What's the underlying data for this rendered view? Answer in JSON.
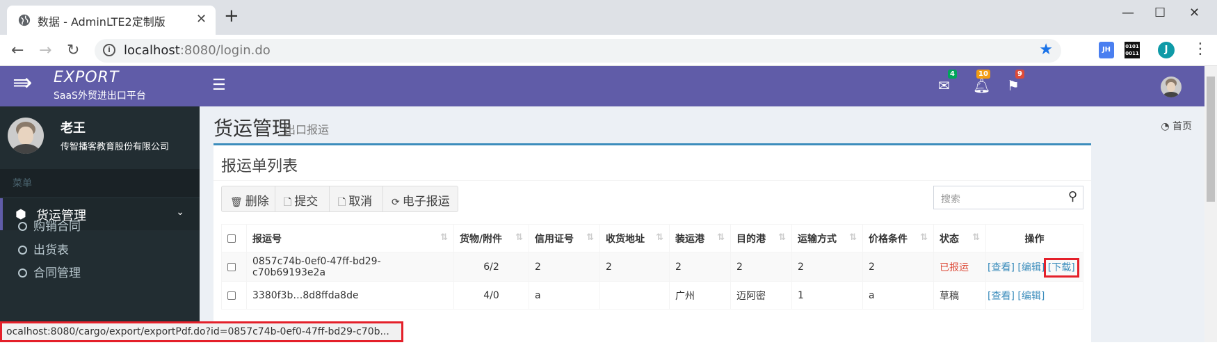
{
  "browser": {
    "tab_title": "数据 - AdminLTE2定制版",
    "url_host": "localhost",
    "url_rest": ":8080/login.do",
    "ext_jh": "JH",
    "ext_code": "0101 0011",
    "profile_initial": "J"
  },
  "logo": {
    "brand": "EXPORT",
    "subtitle": "SaaS外贸进出口平台"
  },
  "user": {
    "name": "老王",
    "company": "传智播客教育股份有限公司"
  },
  "sidebar": {
    "menu_header": "菜单",
    "active_group": "货运管理",
    "items": [
      "购销合同",
      "出货表",
      "合同管理"
    ]
  },
  "topnav": {
    "mail_count": "4",
    "bell_count": "10",
    "flag_count": "9"
  },
  "page": {
    "title": "货运管理",
    "subtitle": "出口报运",
    "breadcrumb": "首页"
  },
  "box": {
    "title": "报运单列表",
    "buttons": [
      "删除",
      "提交",
      "取消",
      "电子报运"
    ],
    "search_placeholder": "搜索"
  },
  "table": {
    "headers": [
      "报运号",
      "货物/附件",
      "信用证号",
      "收货地址",
      "装运港",
      "目的港",
      "运输方式",
      "价格条件",
      "状态",
      "操作"
    ],
    "rows": [
      {
        "no": "0857c74b-0ef0-47ff-bd29-c70b69193e2a",
        "goods": "6/2",
        "lc": "2",
        "addr": "2",
        "port": "2",
        "dest": "2",
        "trans": "2",
        "price": "2",
        "status": "已报运",
        "view": "[查看]",
        "edit": "[编辑]",
        "download": "[下载]"
      },
      {
        "no": "3380f3b…8d8ffda8de",
        "goods": "4/0",
        "lc": "a",
        "addr": "",
        "port": "广州",
        "dest": "迈阿密",
        "trans": "1",
        "price": "a",
        "status": "草稿",
        "view": "[查看]",
        "edit": "[编辑]"
      }
    ]
  },
  "status_url": "ocalhost:8080/cargo/export/exportPdf.do?id=0857c74b-0ef0-47ff-bd29-c70b..."
}
